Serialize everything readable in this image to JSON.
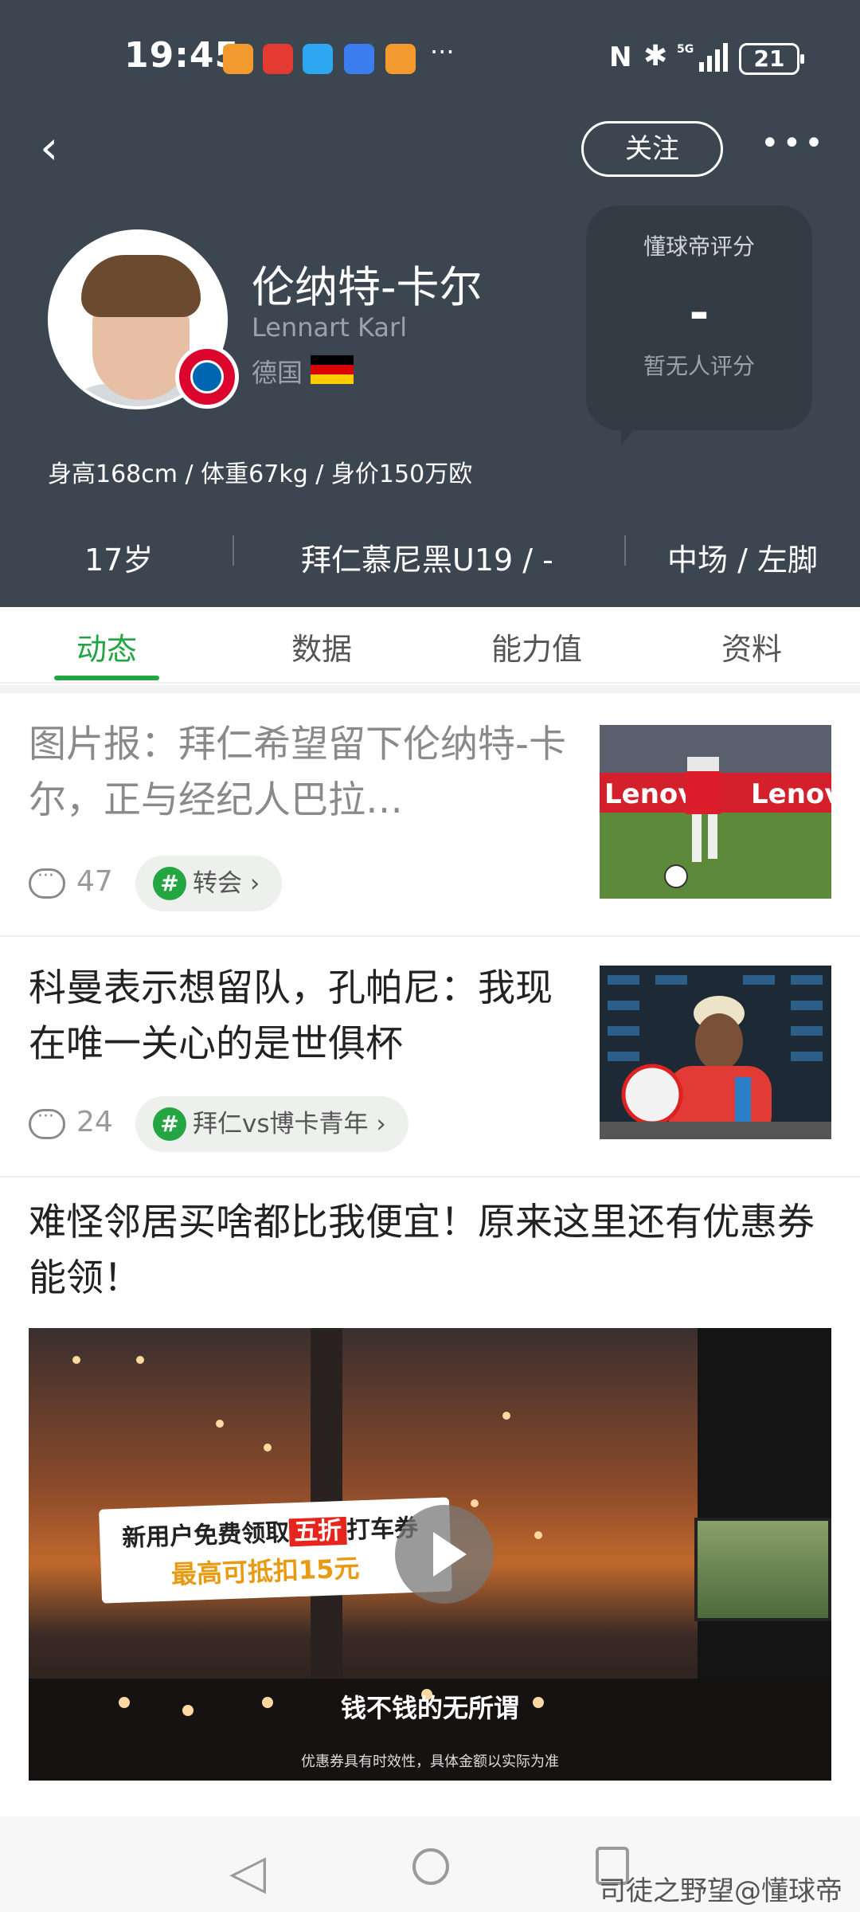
{
  "status_bar": {
    "time": "19:45",
    "battery": "21"
  },
  "header": {
    "follow_label": "关注",
    "player": {
      "name_cn": "伦纳特-卡尔",
      "name_en": "Lennart Karl",
      "nationality": "德国"
    },
    "rating": {
      "title": "懂球帝评分",
      "value": "-",
      "subtitle": "暂无人评分"
    },
    "body_info": "身高168cm / 体重67kg / 身价150万欧",
    "stats": {
      "age": "17岁",
      "club": "拜仁慕尼黑U19 / -",
      "position": "中场 / 左脚"
    }
  },
  "tabs": [
    {
      "label": "动态",
      "active": true
    },
    {
      "label": "数据",
      "active": false
    },
    {
      "label": "能力值",
      "active": false
    },
    {
      "label": "资料",
      "active": false
    }
  ],
  "articles": [
    {
      "title": "图片报：拜仁希望留下伦纳特-卡尔，正与经纪人巴拉…",
      "comments": "47",
      "tag": "转会 ›"
    },
    {
      "title": "科曼表示想留队，孔帕尼：我现在唯一关心的是世俱杯",
      "comments": "24",
      "tag": "拜仁vs博卡青年 ›"
    }
  ],
  "ad": {
    "title": "难怪邻居买啥都比我便宜！原来这里还有优惠券能领！",
    "banner_line1_pre": "新用户免费领取",
    "banner_line1_hl": "五折",
    "banner_line1_post": "打车券",
    "banner_line2": "最高可抵扣15元",
    "subtitle": "钱不钱的无所谓",
    "fine_print": "优惠券具有时效性，具体金额以实际为准"
  },
  "watermark": "司徒之野望@懂球帝",
  "colors": {
    "header_bg": "#3c4650",
    "accent_green": "#23a641",
    "rating_card": "#333c44"
  }
}
